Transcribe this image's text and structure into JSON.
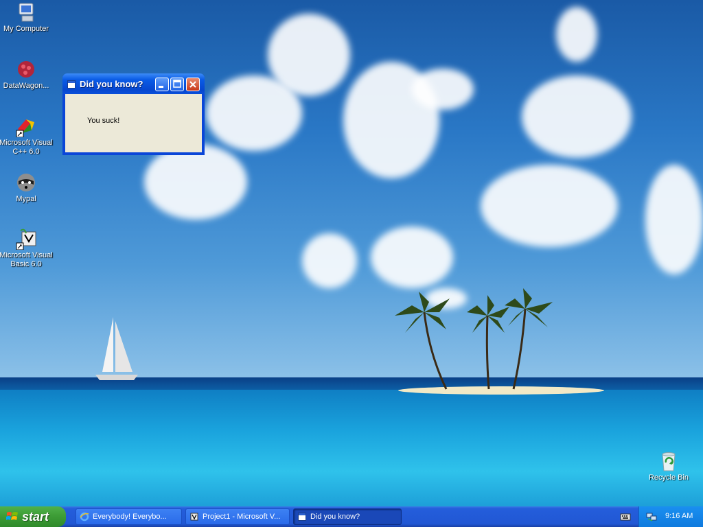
{
  "desktop": {
    "icons": [
      {
        "label": "My Computer",
        "icon": "computer-icon"
      },
      {
        "label": "DataWagon...",
        "icon": "network-globe-icon"
      },
      {
        "label": "Microsoft Visual C++ 6.0",
        "icon": "visual-cpp-icon"
      },
      {
        "label": "Mypal",
        "icon": "raccoon-browser-icon"
      },
      {
        "label": "Microsoft Visual Basic 6.0",
        "icon": "visual-basic-icon"
      },
      {
        "label": "Recycle Bin",
        "icon": "recycle-bin-icon"
      }
    ]
  },
  "dialog": {
    "title": "Did you know?",
    "message": "You suck!"
  },
  "taskbar": {
    "start_label": "start",
    "tasks": [
      {
        "label": "Everybody! Everybo...",
        "icon": "ie-icon",
        "active": false
      },
      {
        "label": "Project1 - Microsoft V...",
        "icon": "vb-project-icon",
        "active": false
      },
      {
        "label": "Did you know?",
        "icon": "window-icon",
        "active": true
      }
    ],
    "clock": "9:16 AM"
  },
  "colors": {
    "titlebar": "#0a5ce6",
    "start_green": "#3c9b35",
    "taskbar_blue": "#245edb",
    "dialog_face": "#ece9d8"
  }
}
